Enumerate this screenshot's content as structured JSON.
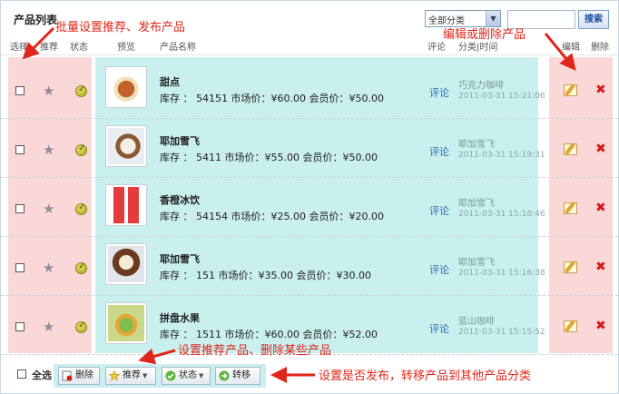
{
  "header": {
    "title": "产品列表"
  },
  "category_select": {
    "value": "全部分类"
  },
  "search": {
    "button_label": "搜索"
  },
  "columns": {
    "select": "选择",
    "recommend": "推荐",
    "status": "状态",
    "preview": "预览",
    "name": "产品名称",
    "review": "评论",
    "category_time": "分类|时间",
    "edit": "编辑",
    "delete": "删除"
  },
  "rows": [
    {
      "name": "甜点",
      "stock_line": "库存 ： 54151 市场价：¥60.00 会员价：¥50.00",
      "review": "评论",
      "category": "巧克力咖啡",
      "time": "2011-03-31 15:21:06"
    },
    {
      "name": "耶加雪飞",
      "stock_line": "库存 ： 5411 市场价：¥55.00 会员价：¥50.00",
      "review": "评论",
      "category": "耶加雪飞",
      "time": "2011-03-31 15:19:31"
    },
    {
      "name": "香橙冰饮",
      "stock_line": "库存 ： 54154 市场价：¥25.00 会员价：¥20.00",
      "review": "评论",
      "category": "耶加雪飞",
      "time": "2011-03-31 15:18:46"
    },
    {
      "name": "耶加雪飞",
      "stock_line": "库存 ： 151 市场价：¥35.00 会员价：¥30.00",
      "review": "评论",
      "category": "耶加雪飞",
      "time": "2011-03-31 15:16:38"
    },
    {
      "name": "拼盘水果",
      "stock_line": "库存 ： 1511 市场价：¥60.00 会员价：¥52.00",
      "review": "评论",
      "category": "蓝山咖啡",
      "time": "2011-03-31 15:15:52"
    }
  ],
  "footer": {
    "select_all": "全选",
    "delete": "删除",
    "recommend": "推荐",
    "status": "状态",
    "move": "转移"
  },
  "annotations": {
    "batch": "批量设置推荐、发布产品",
    "edit": "编辑或删除产品",
    "recommend": "设置推荐产品、删除某些产品",
    "publish": "设置是否发布，转移产品到其他产品分类"
  },
  "colors": {
    "accent_red": "#e0261c",
    "band_pink": "#fbd8d8",
    "band_teal": "#c9efee",
    "link_blue": "#2a6db5"
  },
  "icons": [
    "star-icon",
    "publish-check-icon",
    "edit-icon",
    "delete-icon",
    "dropdown-arrow-icon"
  ]
}
